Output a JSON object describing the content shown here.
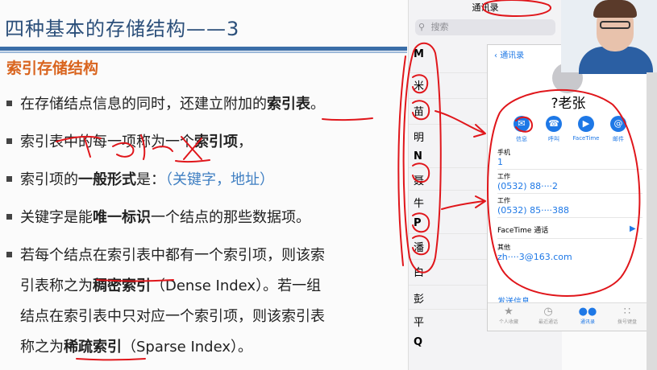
{
  "slide": {
    "title": "四种基本的存储结构——3",
    "section_heading": "索引存储结构",
    "bullets": [
      {
        "pre": "在存储结点信息的同时，还建立附加的",
        "bold": "索引表",
        "post": "。"
      },
      {
        "pre": "索引表中的每一项称为一个",
        "bold": "索引项",
        "post": "，"
      },
      {
        "pre": "索引项的",
        "bold": "一般形式",
        "post": "是：",
        "extra": "（关键字，地址）"
      },
      {
        "pre": "关键字是能",
        "bold": "唯一标识",
        "post": "一个结点的那些数据项。"
      },
      {
        "pre": "若每个结点在索引表中都有一个索引项，则该索"
      }
    ],
    "continuations": [
      {
        "pre": "引表称之为",
        "bold": "稠密索引",
        "post": "（Dense Index）。若一组"
      },
      {
        "text": "结点在索引表中只对应一个索引项，则该索引表"
      },
      {
        "pre": "称之为",
        "bold": "稀疏索引",
        "post": "（Sparse Index）。"
      }
    ],
    "handwriting": "index"
  },
  "phone_list": {
    "header": "通讯录",
    "search_placeholder": "搜索",
    "index_rows": [
      "M",
      "米",
      "苗",
      "明",
      "N",
      "聂",
      "牛",
      "P",
      "潘",
      "白",
      "彭",
      "平",
      "Q"
    ]
  },
  "phone_detail": {
    "back_label": "通讯录",
    "name": "老张",
    "name_prefix": "?",
    "actions": [
      {
        "label": "信息",
        "icon": "message-icon"
      },
      {
        "label": "呼叫",
        "icon": "phone-icon"
      },
      {
        "label": "FaceTime",
        "icon": "video-icon"
      },
      {
        "label": "邮件",
        "icon": "mail-icon"
      }
    ],
    "fields": [
      {
        "key": "手机",
        "value": "1"
      },
      {
        "key": "工作",
        "value": "(0532) 88····2"
      },
      {
        "key": "工作",
        "value": "(0532) 85····388"
      },
      {
        "key": "其他",
        "value": "zh····3@163.com"
      }
    ],
    "facetime_label": "FaceTime 通话",
    "send_message": "发送信息",
    "tabs": [
      {
        "label": "个人收藏",
        "icon": "star-icon"
      },
      {
        "label": "最近通话",
        "icon": "clock-icon"
      },
      {
        "label": "通讯录",
        "icon": "contacts-icon"
      },
      {
        "label": "拨号键盘",
        "icon": "keypad-icon"
      }
    ]
  },
  "colors": {
    "title": "#2b4f7a",
    "section": "#d9641e",
    "accent_blue": "#3f7fc2",
    "ios_blue": "#1e78e6",
    "ink_red": "#e0161b"
  }
}
